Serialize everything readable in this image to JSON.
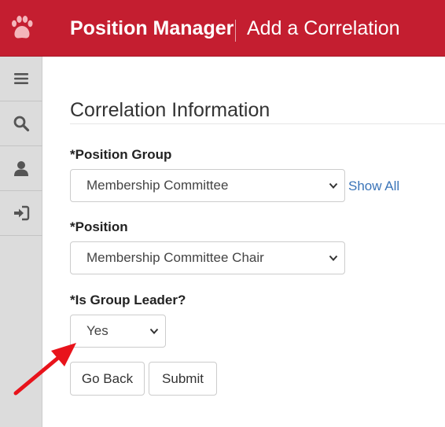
{
  "header": {
    "app_title": "Position Manager",
    "page_heading": "Add a Correlation",
    "brand_color": "#c41e30"
  },
  "sidebar": {
    "items": [
      {
        "icon": "hamburger-menu-icon"
      },
      {
        "icon": "search-icon"
      },
      {
        "icon": "user-icon"
      },
      {
        "icon": "sign-in-icon"
      }
    ]
  },
  "form": {
    "section_title": "Correlation Information",
    "position_group": {
      "label": "*Position Group",
      "value": "Membership Committee",
      "show_all_label": "Show All"
    },
    "position": {
      "label": "*Position",
      "value": "Membership Committee Chair"
    },
    "is_group_leader": {
      "label": "*Is Group Leader?",
      "value": "Yes"
    },
    "buttons": {
      "go_back": "Go Back",
      "submit": "Submit"
    }
  },
  "annotation": {
    "arrow_color": "#e8131b"
  }
}
